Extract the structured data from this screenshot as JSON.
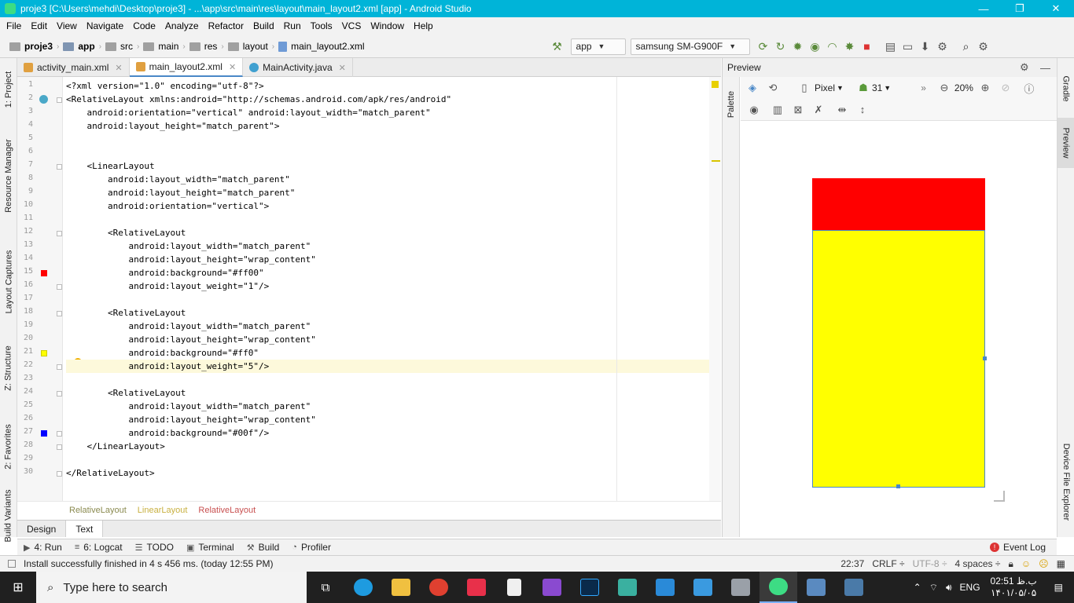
{
  "window": {
    "title": "proje3 [C:\\Users\\mehdi\\Desktop\\proje3] - ...\\app\\src\\main\\res\\layout\\main_layout2.xml [app] - Android Studio",
    "minimize": "—",
    "restore": "❐",
    "close": "✕"
  },
  "menu": [
    "File",
    "Edit",
    "View",
    "Navigate",
    "Code",
    "Analyze",
    "Refactor",
    "Build",
    "Run",
    "Tools",
    "VCS",
    "Window",
    "Help"
  ],
  "nav": {
    "crumbs": [
      "proje3",
      "app",
      "src",
      "main",
      "res",
      "layout",
      "main_layout2.xml"
    ],
    "run_config": "app",
    "device": "samsung SM-G900F"
  },
  "tabs": [
    {
      "label": "activity_main.xml",
      "active": false
    },
    {
      "label": "main_layout2.xml",
      "active": true
    },
    {
      "label": "MainActivity.java",
      "active": false
    }
  ],
  "left_strip": [
    "1: Project",
    "Resource Manager",
    "Layout Captures",
    "Z: Structure",
    "2: Favorites",
    "Build Variants"
  ],
  "right_strip": [
    "Gradle",
    "Preview",
    "Device File Explorer"
  ],
  "editor": {
    "line_numbers": [
      "1",
      "2",
      "3",
      "4",
      "5",
      "6",
      "7",
      "8",
      "9",
      "10",
      "11",
      "12",
      "13",
      "14",
      "15",
      "16",
      "17",
      "18",
      "19",
      "20",
      "21",
      "22",
      "23",
      "24",
      "25",
      "26",
      "27",
      "28",
      "29",
      "30"
    ],
    "lines": [
      "<?xml version=\"1.0\" encoding=\"utf-8\"?>",
      "<RelativeLayout xmlns:android=\"http://schemas.android.com/apk/res/android\"",
      "    android:orientation=\"vertical\" android:layout_width=\"match_parent\"",
      "    android:layout_height=\"match_parent\">",
      "",
      "",
      "    <LinearLayout",
      "        android:layout_width=\"match_parent\"",
      "        android:layout_height=\"match_parent\"",
      "        android:orientation=\"vertical\">",
      "",
      "        <RelativeLayout",
      "            android:layout_width=\"match_parent\"",
      "            android:layout_height=\"wrap_content\"",
      "            android:background=\"#ff00\"",
      "            android:layout_weight=\"1\"/>",
      "",
      "        <RelativeLayout",
      "            android:layout_width=\"match_parent\"",
      "            android:layout_height=\"wrap_content\"",
      "            android:background=\"#ff0\"",
      "            android:layout_weight=\"5\"/>",
      "",
      "        <RelativeLayout",
      "            android:layout_width=\"match_parent\"",
      "            android:layout_height=\"wrap_content\"",
      "            android:background=\"#00f\"/>",
      "    </LinearLayout>",
      "",
      "</RelativeLayout>"
    ],
    "breadcrumb": [
      "RelativeLayout",
      "LinearLayout",
      "RelativeLayout"
    ]
  },
  "view_tabs": [
    "Design",
    "Text"
  ],
  "preview": {
    "title": "Preview",
    "device": "Pixel",
    "api": "31",
    "zoom": "20%",
    "colors": {
      "top": "#ff0000",
      "middle": "#ffff00"
    }
  },
  "bottom_tools": [
    {
      "icon": "▶",
      "label": "4: Run"
    },
    {
      "icon": "≡",
      "label": "6: Logcat"
    },
    {
      "icon": "☰",
      "label": "TODO"
    },
    {
      "icon": "▣",
      "label": "Terminal"
    },
    {
      "icon": "⚒",
      "label": "Build"
    },
    {
      "icon": "◔",
      "label": "Profiler"
    }
  ],
  "event_log": "Event Log",
  "status": {
    "message": "Install successfully finished in 4 s 456 ms. (today 12:55 PM)",
    "position": "22:37",
    "line_sep": "CRLF ÷",
    "encoding": "UTF-8 ÷",
    "indent": "4 spaces ÷"
  },
  "taskbar": {
    "search_placeholder": "Type here to search",
    "lang": "ENG",
    "time": "02:51 ب.ظ",
    "date": "۱۴۰۱/۰۵/۰۵"
  }
}
